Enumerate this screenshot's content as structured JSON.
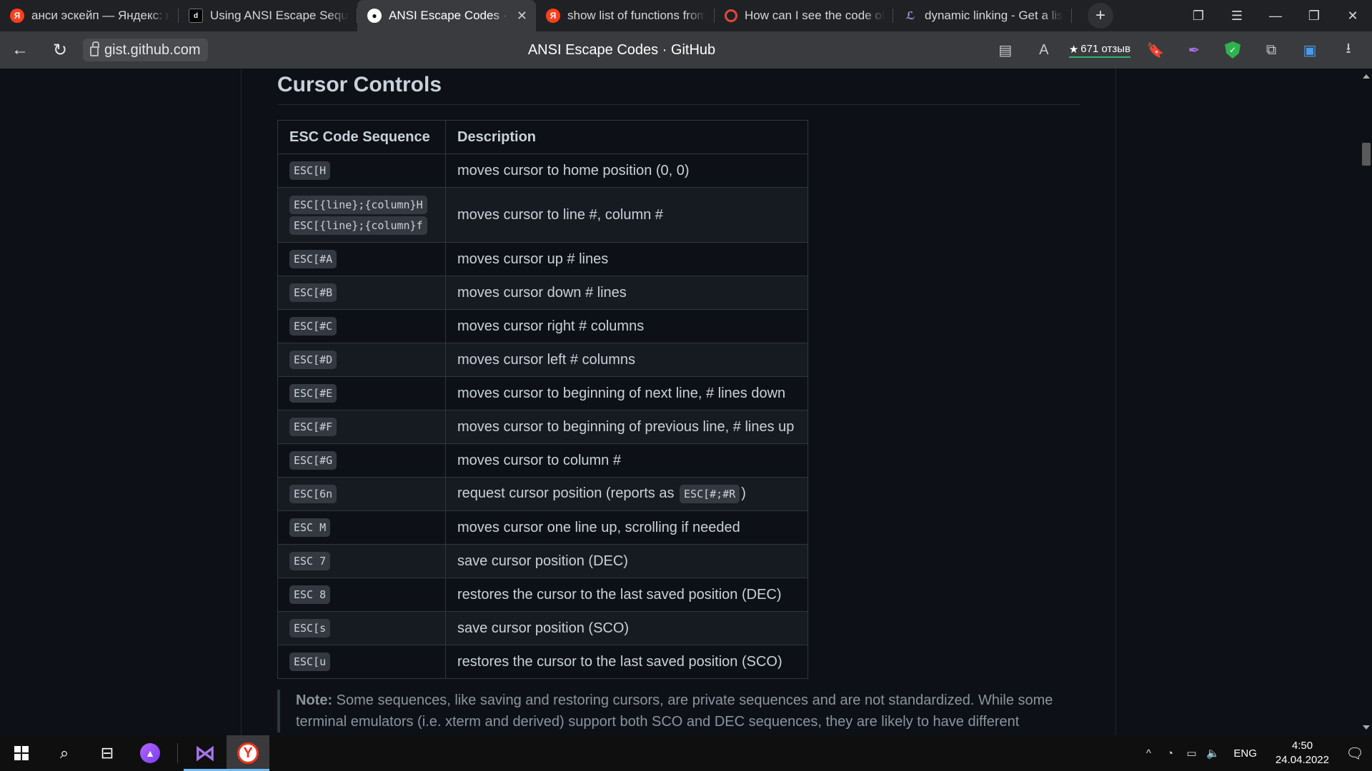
{
  "browser": {
    "tabs": [
      {
        "title": "анси эскейп — Яндекс: на",
        "favicon": "yandex-icon"
      },
      {
        "title": "Using ANSI Escape Sequen",
        "favicon": "dev-icon"
      },
      {
        "title": "ANSI Escape Codes · GitH",
        "favicon": "github-icon",
        "active": true
      },
      {
        "title": "show list of functions from",
        "favicon": "yandex-icon"
      },
      {
        "title": "How can I see the code of t",
        "favicon": "quora-icon"
      },
      {
        "title": "dynamic linking - Get a list",
        "favicon": "duckduckgo-icon"
      }
    ],
    "new_tab": "+",
    "url": "gist.github.com",
    "page_title": "ANSI Escape Codes · GitHub",
    "rating": "671 отзыв"
  },
  "page": {
    "section_title": "Cursor Controls",
    "table": {
      "headers": [
        "ESC Code Sequence",
        "Description"
      ],
      "rows": [
        {
          "codes": [
            "ESC[H"
          ],
          "description": "moves cursor to home position (0, 0)"
        },
        {
          "codes": [
            "ESC[{line};{column}H",
            "ESC[{line};{column}f"
          ],
          "description": "moves cursor to line #, column #"
        },
        {
          "codes": [
            "ESC[#A"
          ],
          "description": "moves cursor up # lines"
        },
        {
          "codes": [
            "ESC[#B"
          ],
          "description": "moves cursor down # lines"
        },
        {
          "codes": [
            "ESC[#C"
          ],
          "description": "moves cursor right # columns"
        },
        {
          "codes": [
            "ESC[#D"
          ],
          "description": "moves cursor left # columns"
        },
        {
          "codes": [
            "ESC[#E"
          ],
          "description": "moves cursor to beginning of next line, # lines down"
        },
        {
          "codes": [
            "ESC[#F"
          ],
          "description": "moves cursor to beginning of previous line, # lines up"
        },
        {
          "codes": [
            "ESC[#G"
          ],
          "description": "moves cursor to column #"
        },
        {
          "codes": [
            "ESC[6n"
          ],
          "description": "request cursor position (reports as ",
          "inline_code": "ESC[#;#R",
          "description_after": ")"
        },
        {
          "codes": [
            "ESC M"
          ],
          "description": "moves cursor one line up, scrolling if needed"
        },
        {
          "codes": [
            "ESC 7"
          ],
          "description": "save cursor position (DEC)"
        },
        {
          "codes": [
            "ESC 8"
          ],
          "description": "restores the cursor to the last saved position (DEC)"
        },
        {
          "codes": [
            "ESC[s"
          ],
          "description": "save cursor position (SCO)"
        },
        {
          "codes": [
            "ESC[u"
          ],
          "description": "restores the cursor to the last saved position (SCO)"
        }
      ]
    },
    "note": {
      "label": "Note:",
      "text": " Some sequences, like saving and restoring cursors, are private sequences and are not standardized. While some terminal emulators (i.e. xterm and derived) support both SCO and DEC sequences, they are likely to have different"
    }
  },
  "taskbar": {
    "lang": "ENG",
    "time": "4:50",
    "date": "24.04.2022"
  },
  "colors": {
    "page_bg": "#0d1117",
    "text": "#c9d1d9",
    "border": "#30363d",
    "code_bg": "#343941",
    "tab_active_bg": "#3a3b3e",
    "rating_underline": "#2fb36b"
  }
}
